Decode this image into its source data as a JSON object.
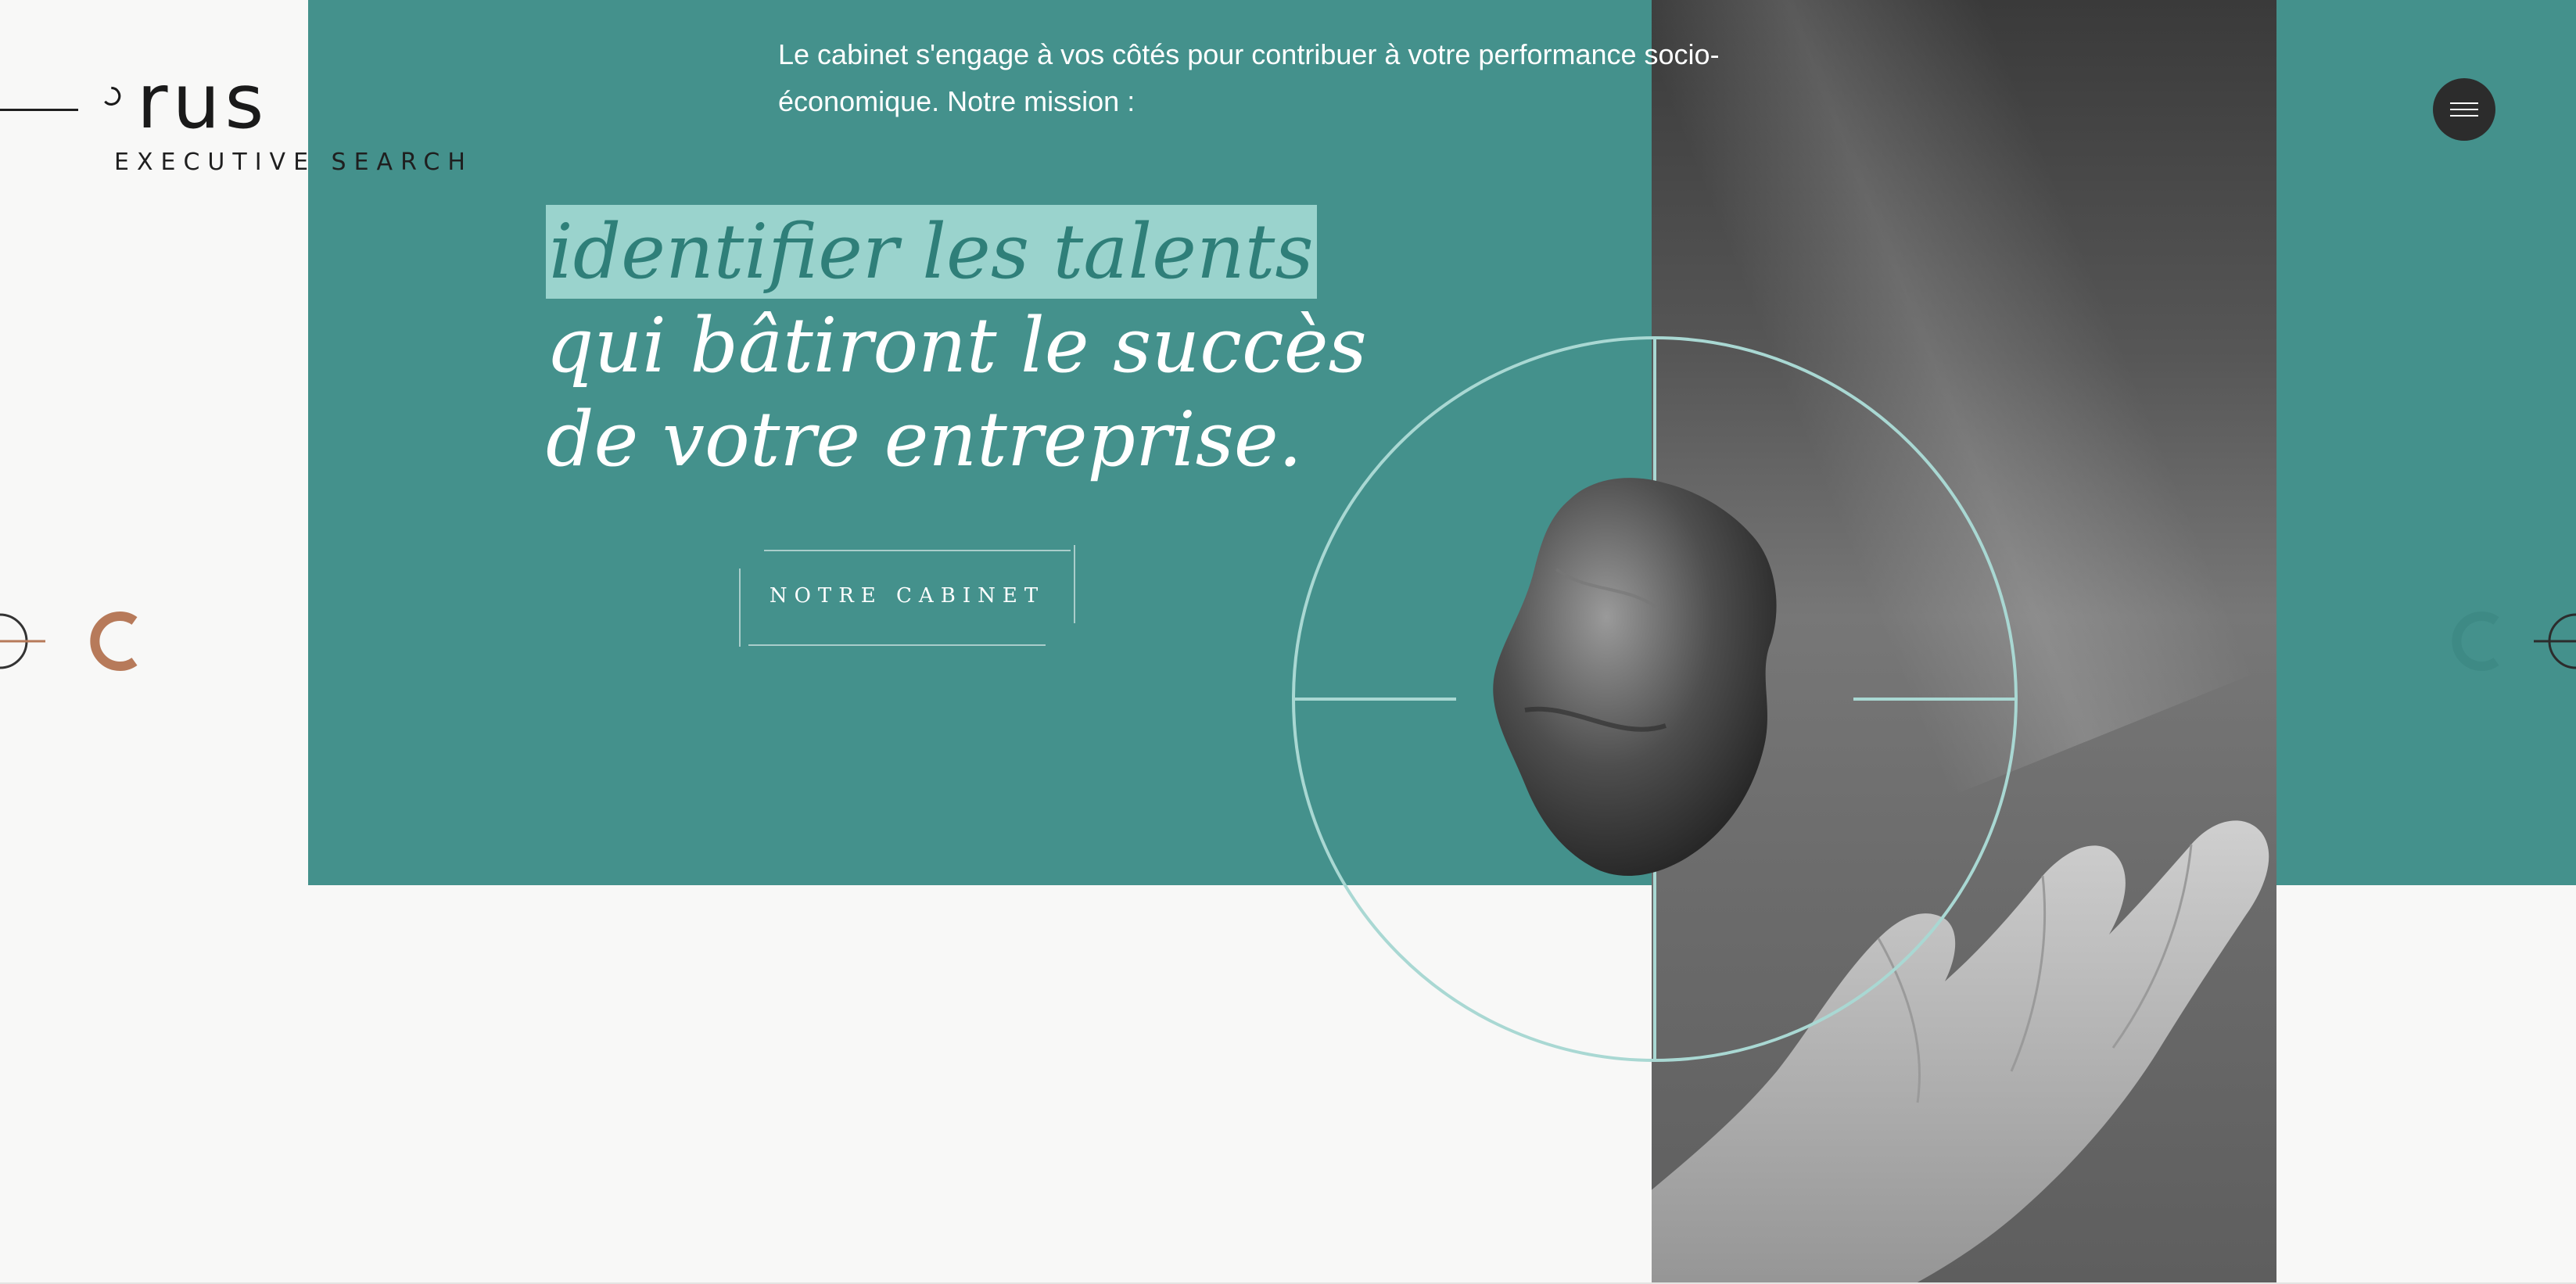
{
  "brand": {
    "name": "rus",
    "tagline": "EXECUTIVE SEARCH"
  },
  "intro": {
    "text": "Le cabinet s'engage à vos côtés pour contribuer à votre performance socio-économique. Notre mission :"
  },
  "headline": {
    "highlight": "identifier les talents",
    "line2": "qui bâtiront le succès",
    "line3": "de votre entreprise."
  },
  "cta": {
    "label": "NOTRE CABINET"
  },
  "colors": {
    "teal": "#44918c",
    "highlight": "#9ad3cd",
    "accent_copper": "#b77a5a",
    "dark": "#2c2c2c"
  },
  "icons": {
    "menu": "hamburger-icon",
    "prev": "prev-arrow-icon",
    "next": "next-arrow-icon"
  }
}
